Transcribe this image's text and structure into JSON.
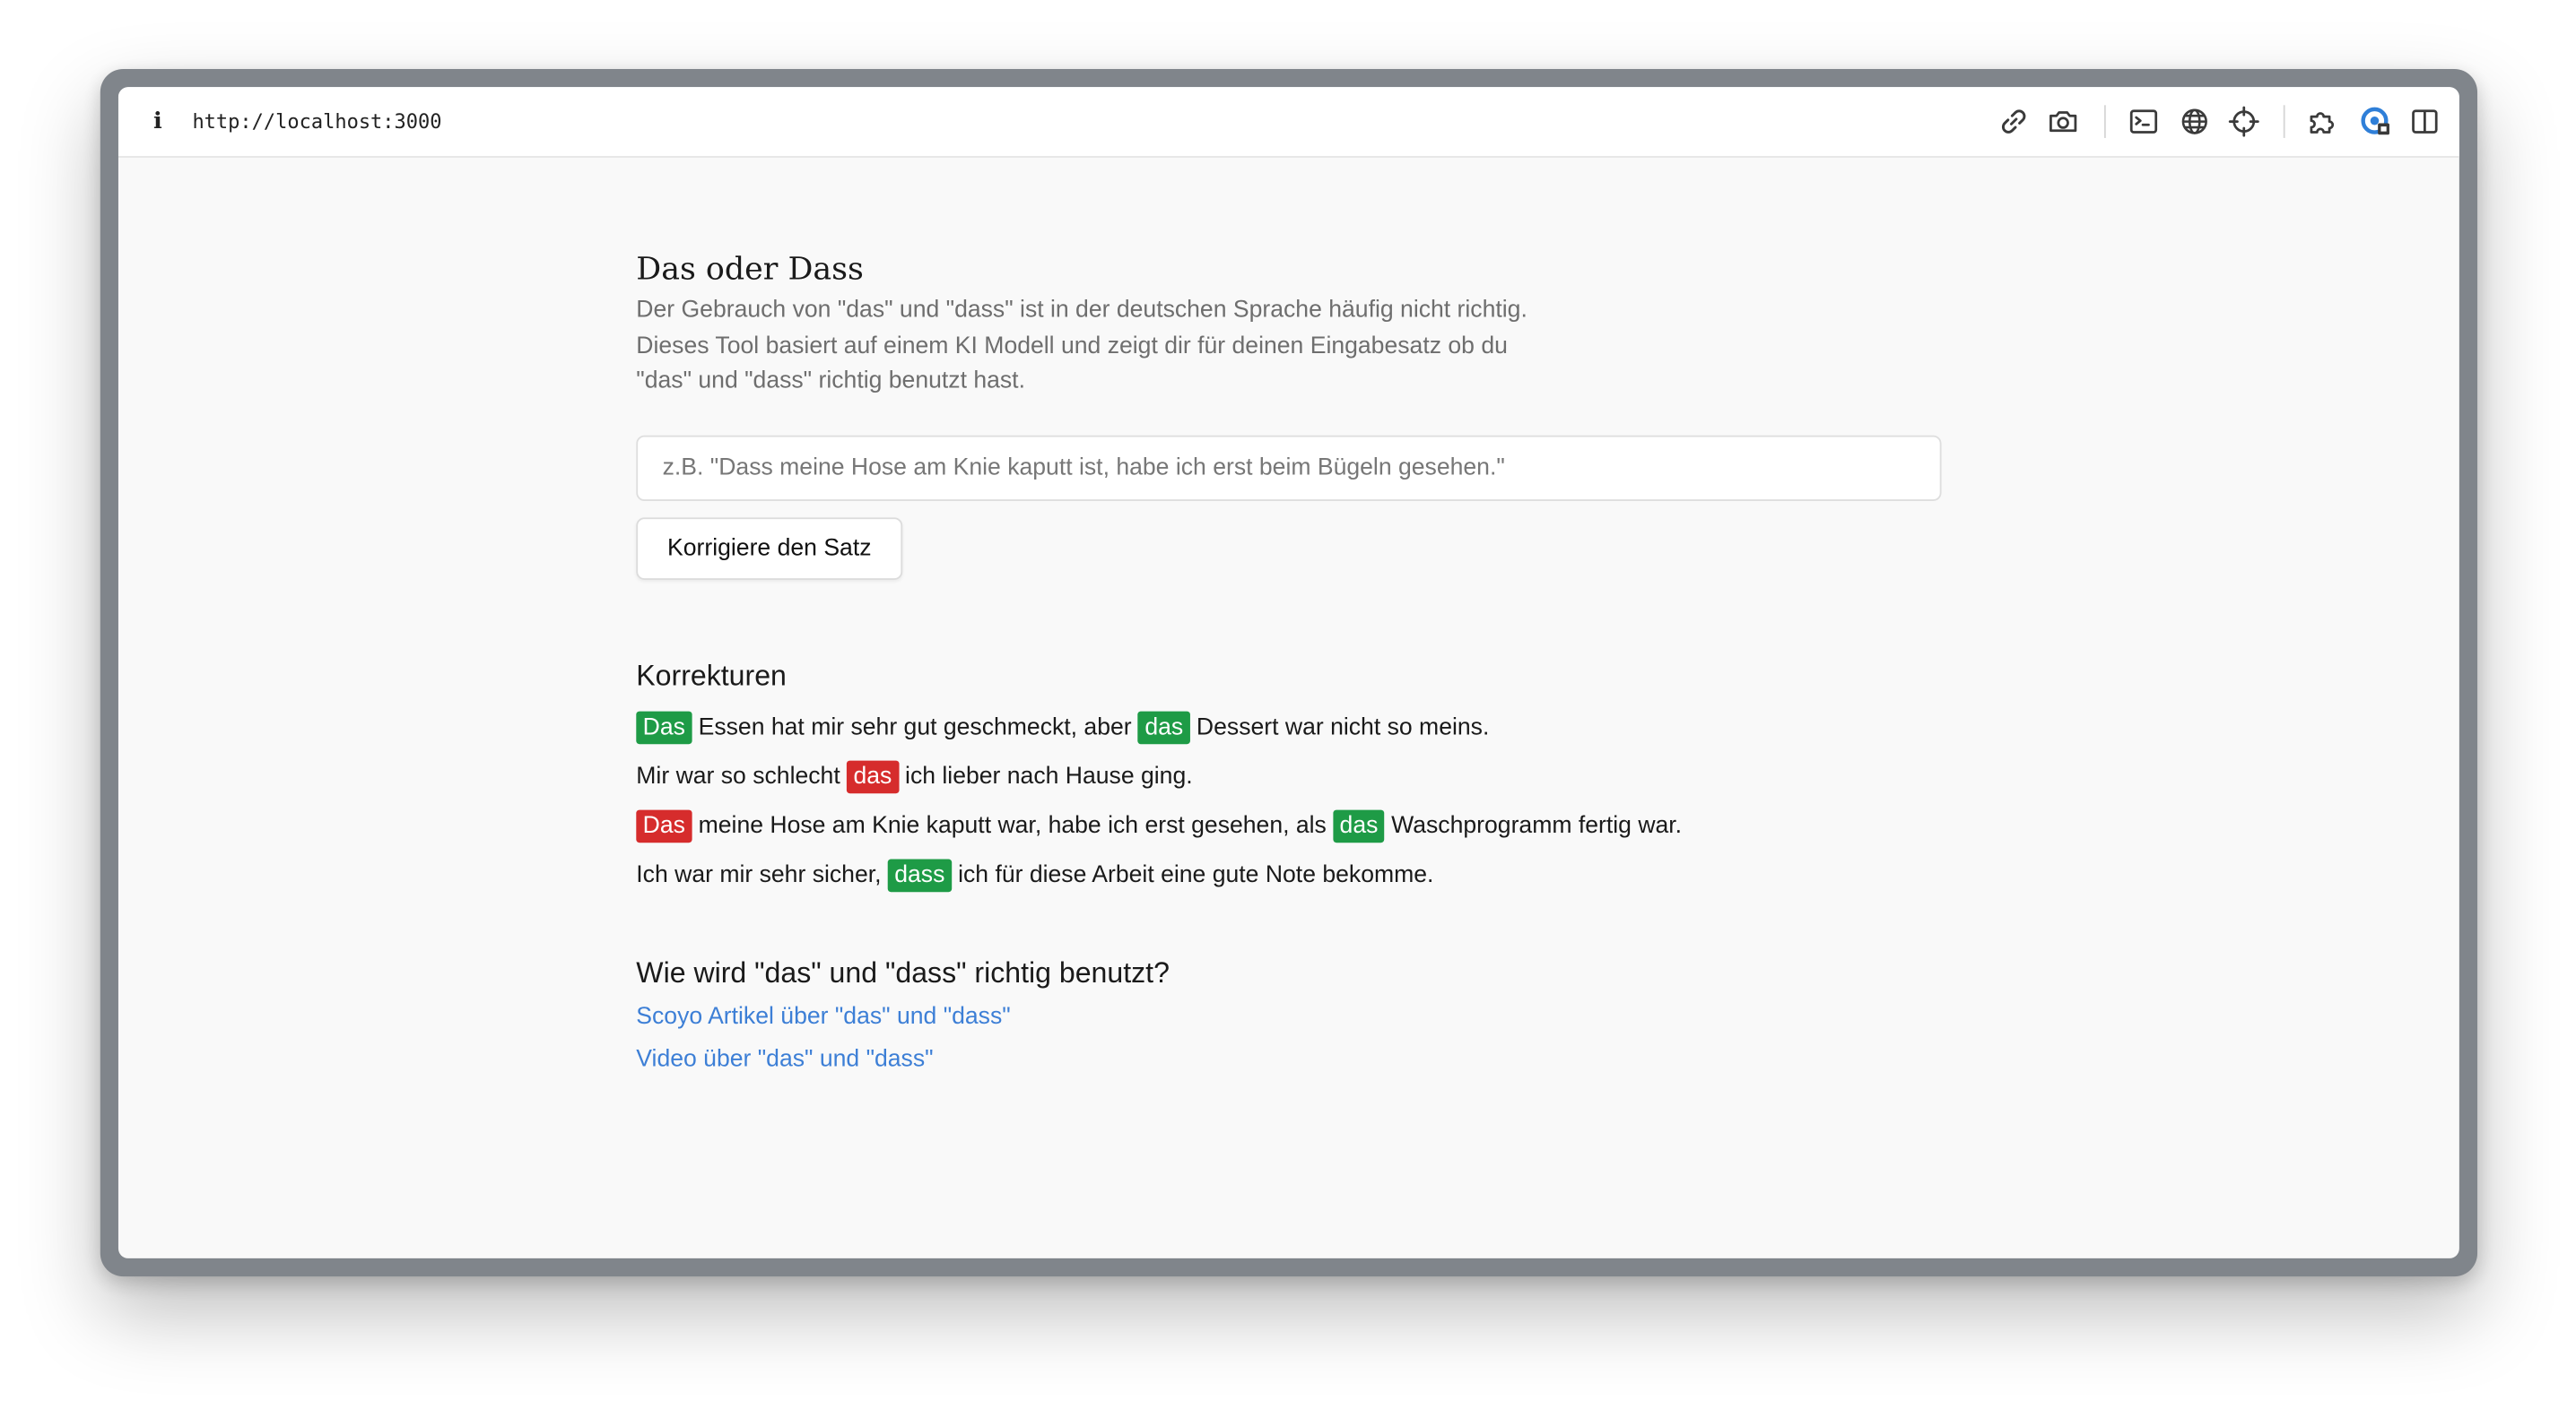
{
  "browser": {
    "url": "http://localhost:3000",
    "info_glyph": "i",
    "toolbar_icons": [
      "link-icon",
      "camera-icon",
      "terminal-icon",
      "globe-icon",
      "crosshair-icon",
      "extensions-icon",
      "profile-icon",
      "sidebar-icon"
    ]
  },
  "page": {
    "title": "Das oder Dass",
    "description_lines": [
      "Der Gebrauch von \"das\" und \"dass\" ist in der deutschen Sprache häufig nicht richtig.",
      "Dieses Tool basiert auf einem KI Modell und zeigt dir für deinen Eingabesatz ob du",
      "\"das\" und \"dass\" richtig benutzt hast."
    ],
    "input": {
      "value": "",
      "placeholder": "z.B. \"Dass meine Hose am Knie kaputt ist, habe ich erst beim Bügeln gesehen.\""
    },
    "button_label": "Korrigiere den Satz"
  },
  "corrections": {
    "heading": "Korrekturen",
    "legend_colors": {
      "correct": "#1e9b46",
      "incorrect": "#d62c2c"
    },
    "lines": [
      [
        {
          "text": "Das",
          "status": "correct"
        },
        {
          "text": " Essen hat mir sehr gut geschmeckt, aber "
        },
        {
          "text": "das",
          "status": "correct"
        },
        {
          "text": " Dessert war nicht so meins."
        }
      ],
      [
        {
          "text": "Mir war so schlecht "
        },
        {
          "text": "das",
          "status": "incorrect"
        },
        {
          "text": " ich lieber nach Hause ging."
        }
      ],
      [
        {
          "text": "Das",
          "status": "incorrect"
        },
        {
          "text": " meine Hose am Knie kaputt war, habe ich erst gesehen, als "
        },
        {
          "text": "das",
          "status": "correct"
        },
        {
          "text": " Waschprogramm fertig war."
        }
      ],
      [
        {
          "text": "Ich war mir sehr sicher, "
        },
        {
          "text": "dass",
          "status": "correct"
        },
        {
          "text": " ich für diese Arbeit eine gute Note bekomme."
        }
      ]
    ]
  },
  "help": {
    "heading": "Wie wird \"das\" und \"dass\" richtig benutzt?",
    "links": [
      {
        "label": "Scoyo Artikel über \"das\" und \"dass\""
      },
      {
        "label": "Video über \"das\" und \"dass\""
      }
    ]
  }
}
